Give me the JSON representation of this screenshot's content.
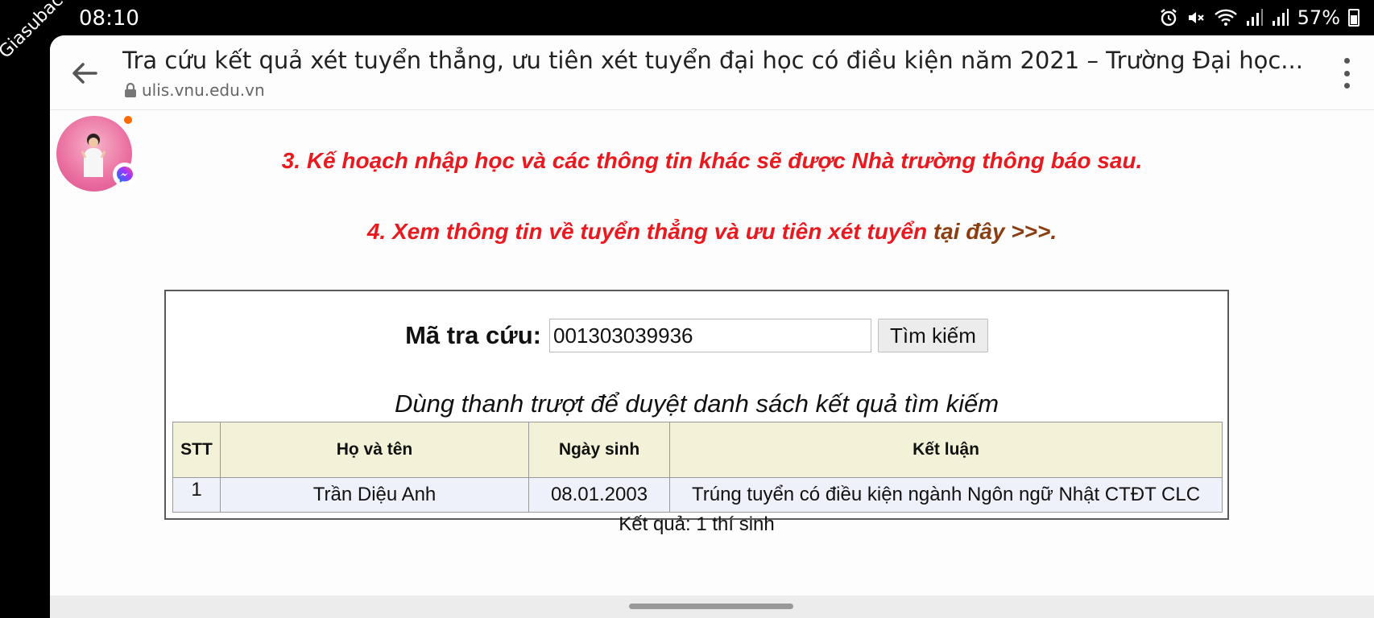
{
  "status_bar": {
    "time": "08:10",
    "battery": "57%",
    "icons": [
      "alarm-icon",
      "mute-icon",
      "wifi-icon",
      "signal-icon",
      "signal-icon",
      "battery-icon"
    ]
  },
  "watermark": "Giasubachkhoa.net",
  "browser": {
    "title": "Tra cứu kết quả xét tuyển thẳng, ưu tiên xét tuyển đại học có điều kiện năm 2021 – Trường Đại học...",
    "url": "ulis.vnu.edu.vn"
  },
  "notices": {
    "item3": "3. Kế hoạch nhập học và các thông tin khác sẽ được Nhà trường thông báo sau.",
    "item4_prefix": "4. Xem thông tin về tuyển thẳng và ưu tiên xét tuyển ",
    "item4_link": "tại đây",
    "item4_suffix": " >>>."
  },
  "search": {
    "label": "Mã tra cứu:",
    "value": "001303039936",
    "button": "Tìm kiếm"
  },
  "caption": "Dùng thanh trượt để duyệt danh sách kết quả tìm kiếm",
  "table": {
    "headers": [
      "STT",
      "Họ và tên",
      "Ngày sinh",
      "Kết luận"
    ],
    "rows": [
      [
        "1",
        "Trần Diệu Anh",
        "08.01.2003",
        "Trúng tuyển có điều kiện ngành Ngôn ngữ Nhật CTĐT CLC"
      ]
    ]
  },
  "total": "Kết quả: 1 thí sinh"
}
